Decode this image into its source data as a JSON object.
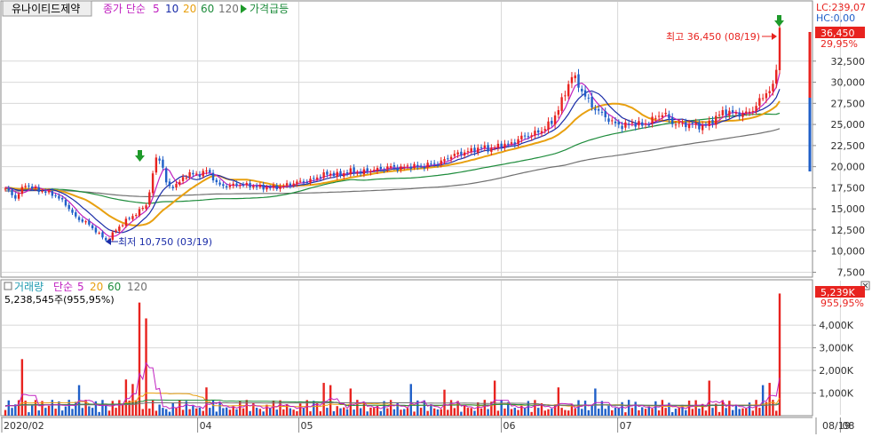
{
  "header": {
    "stock_name": "유나이티드제약",
    "price_legend_prefix": "종가 단순",
    "price_ma_periods": [
      "5",
      "10",
      "20",
      "60",
      "120"
    ],
    "alert_label": "가격급등",
    "lc_readout": "LC:239,07",
    "hc_readout": "HC:0,00"
  },
  "price_panel": {
    "current_price_tag": "36,450",
    "current_change_tag": "29,95%",
    "high_annotation": "최고 36,450 (08/19)",
    "low_annotation": "최저 10,750 (03/19)"
  },
  "volume_panel": {
    "legend_name": "거래량",
    "legend_prefix": "단순",
    "ma_periods": [
      "5",
      "20",
      "60",
      "120"
    ],
    "current_volume_text": "5,238,545주(955,95%)",
    "current_volume_tag": "5,239K",
    "current_change_tag": "955,95%"
  },
  "colors": {
    "up": "#e8231f",
    "down": "#1f5fc8",
    "ma5": "#c020c0",
    "ma10": "#1a2ca8",
    "ma20": "#e8a010",
    "ma60": "#1e8c3c",
    "ma120": "#707070",
    "signal_arrow": "#1e9a2a",
    "grid": "#d8d8d8"
  },
  "chart_data": {
    "type": "candlestick",
    "price_axis": {
      "ylim": [
        6500,
        39000
      ],
      "ticks": [
        7500,
        10000,
        12500,
        15000,
        17500,
        20000,
        22500,
        25000,
        27500,
        30000,
        32500
      ],
      "tick_labels": [
        "7,500",
        "10,000",
        "12,500",
        "15,000",
        "17,500",
        "20,000",
        "22,500",
        "25,000",
        "27,500",
        "30,000",
        "32,500"
      ]
    },
    "volume_axis": {
      "ylim": [
        0,
        5300000
      ],
      "ticks": [
        1000000,
        2000000,
        3000000,
        4000000
      ],
      "tick_labels": [
        "1,000K",
        "2,000K",
        "3,000K",
        "4,000K"
      ]
    },
    "time_axis": {
      "labels": [
        "2020/02",
        "04",
        "05",
        "06",
        "07",
        "08"
      ],
      "last_label": "08/19"
    },
    "price_keyframes": [
      [
        0,
        17400
      ],
      [
        2,
        16300
      ],
      [
        4,
        17900
      ],
      [
        6,
        17300
      ],
      [
        8,
        17000
      ],
      [
        10,
        16600
      ],
      [
        12,
        15500
      ],
      [
        14,
        13900
      ],
      [
        16,
        13400
      ],
      [
        18,
        12300
      ],
      [
        20,
        11200
      ],
      [
        22,
        12600
      ],
      [
        24,
        13700
      ],
      [
        26,
        14500
      ],
      [
        28,
        15600
      ],
      [
        30,
        21600
      ],
      [
        31,
        20200
      ],
      [
        32,
        17500
      ],
      [
        34,
        17900
      ],
      [
        36,
        19200
      ],
      [
        38,
        19000
      ],
      [
        40,
        19600
      ],
      [
        42,
        17800
      ],
      [
        44,
        17700
      ],
      [
        46,
        17900
      ],
      [
        48,
        17800
      ],
      [
        50,
        17600
      ],
      [
        52,
        17500
      ],
      [
        54,
        17600
      ],
      [
        56,
        17900
      ],
      [
        58,
        18200
      ],
      [
        60,
        18300
      ],
      [
        62,
        18900
      ],
      [
        64,
        19200
      ],
      [
        66,
        19000
      ],
      [
        68,
        19500
      ],
      [
        70,
        19300
      ],
      [
        72,
        19600
      ],
      [
        74,
        19700
      ],
      [
        76,
        20000
      ],
      [
        78,
        19800
      ],
      [
        80,
        20100
      ],
      [
        82,
        20000
      ],
      [
        84,
        20300
      ],
      [
        86,
        20500
      ],
      [
        88,
        21300
      ],
      [
        90,
        21600
      ],
      [
        92,
        21900
      ],
      [
        94,
        22300
      ],
      [
        96,
        22100
      ],
      [
        98,
        22600
      ],
      [
        100,
        22700
      ],
      [
        102,
        23500
      ],
      [
        104,
        23800
      ],
      [
        106,
        24300
      ],
      [
        108,
        25300
      ],
      [
        110,
        27800
      ],
      [
        112,
        30900
      ],
      [
        114,
        28900
      ],
      [
        116,
        27100
      ],
      [
        118,
        26200
      ],
      [
        120,
        25200
      ],
      [
        122,
        24800
      ],
      [
        124,
        25200
      ],
      [
        126,
        24900
      ],
      [
        128,
        25600
      ],
      [
        130,
        26400
      ],
      [
        132,
        25100
      ],
      [
        134,
        25000
      ],
      [
        136,
        25000
      ],
      [
        138,
        24700
      ],
      [
        140,
        25600
      ],
      [
        142,
        26600
      ],
      [
        144,
        26300
      ],
      [
        146,
        26200
      ],
      [
        148,
        26900
      ],
      [
        150,
        28600
      ],
      [
        152,
        29500
      ],
      [
        153,
        36450
      ]
    ],
    "volume_bars": [
      [
        5,
        2500000
      ],
      [
        22,
        1350000
      ],
      [
        36,
        1600000
      ],
      [
        38,
        1400000
      ],
      [
        40,
        5000000
      ],
      [
        42,
        4300000
      ],
      [
        60,
        1250000
      ],
      [
        95,
        1450000
      ],
      [
        97,
        1350000
      ],
      [
        103,
        1200000
      ],
      [
        121,
        1400000
      ],
      [
        131,
        1150000
      ],
      [
        146,
        1550000
      ],
      [
        165,
        1250000
      ],
      [
        176,
        1200000
      ],
      [
        210,
        1550000
      ],
      [
        226,
        1350000
      ],
      [
        228,
        1450000
      ],
      [
        231,
        5400000
      ]
    ],
    "volume_base": [
      0,
      1,
      3,
      4,
      6,
      8,
      9,
      11,
      13,
      14,
      16,
      18,
      19,
      21,
      24,
      25,
      27,
      29,
      30,
      32,
      34,
      35,
      37,
      39,
      44,
      46,
      48,
      50,
      52,
      54,
      56,
      58,
      62,
      64,
      66,
      68,
      70,
      72,
      74,
      76,
      78,
      80,
      82,
      84,
      86,
      88,
      90,
      92,
      93,
      99,
      101,
      105,
      107,
      109,
      111,
      113,
      115,
      117,
      119,
      123,
      125,
      127,
      129,
      133,
      135,
      137,
      139,
      141,
      143,
      145,
      148,
      150,
      152,
      154,
      156,
      158,
      160,
      162,
      164,
      167,
      169,
      171,
      173,
      175,
      178,
      180,
      182,
      184,
      186,
      188,
      190,
      192,
      194,
      196,
      198,
      200,
      202,
      204,
      206,
      208,
      212,
      214,
      216,
      218,
      220,
      222,
      224,
      227,
      229
    ]
  }
}
